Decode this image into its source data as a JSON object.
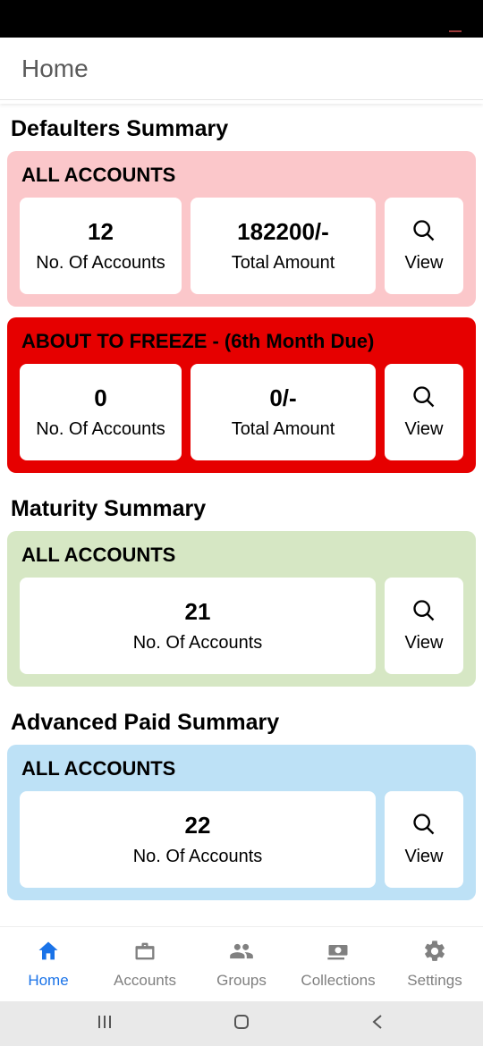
{
  "app_bar": {
    "title": "Home"
  },
  "sections": {
    "defaulters": {
      "title": "Defaulters Summary",
      "all": {
        "panel_title": "ALL ACCOUNTS",
        "accounts_value": "12",
        "accounts_label": "No. Of Accounts",
        "amount_value": "182200/-",
        "amount_label": "Total Amount",
        "view_label": "View"
      },
      "freeze": {
        "panel_title": "ABOUT TO FREEZE - (6th Month Due)",
        "accounts_value": "0",
        "accounts_label": "No. Of Accounts",
        "amount_value": "0/-",
        "amount_label": "Total Amount",
        "view_label": "View"
      }
    },
    "maturity": {
      "title": "Maturity Summary",
      "all": {
        "panel_title": "ALL ACCOUNTS",
        "accounts_value": "21",
        "accounts_label": "No. Of Accounts",
        "view_label": "View"
      }
    },
    "advanced": {
      "title": "Advanced Paid Summary",
      "all": {
        "panel_title": "ALL ACCOUNTS",
        "accounts_value": "22",
        "accounts_label": "No. Of Accounts",
        "view_label": "View"
      }
    }
  },
  "bottom_nav": {
    "home": "Home",
    "accounts": "Accounts",
    "groups": "Groups",
    "collections": "Collections",
    "settings": "Settings"
  }
}
